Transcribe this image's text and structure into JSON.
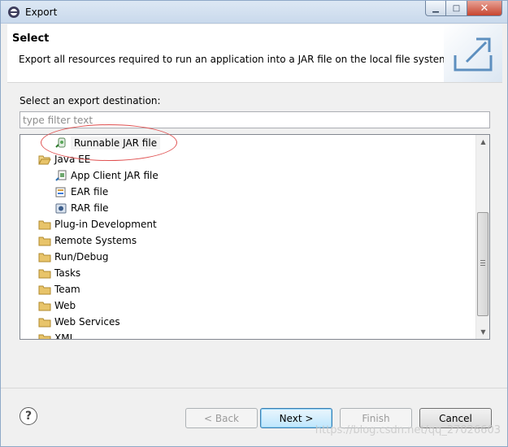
{
  "window": {
    "title": "Export"
  },
  "header": {
    "title": "Select",
    "description": "Export all resources required to run an application into a JAR file on the local file system."
  },
  "body": {
    "dest_label": "Select an export destination:",
    "filter_placeholder": "type filter text"
  },
  "tree": {
    "items": [
      {
        "label": "Runnable JAR file",
        "icon": "jar-runnable-icon",
        "level": 1
      },
      {
        "label": "Java EE",
        "icon": "folder-open-icon",
        "level": 0
      },
      {
        "label": "App Client JAR file",
        "icon": "app-client-icon",
        "level": 1
      },
      {
        "label": "EAR file",
        "icon": "ear-icon",
        "level": 1
      },
      {
        "label": "RAR file",
        "icon": "rar-icon",
        "level": 1
      },
      {
        "label": "Plug-in Development",
        "icon": "folder-icon",
        "level": 0
      },
      {
        "label": "Remote Systems",
        "icon": "folder-icon",
        "level": 0
      },
      {
        "label": "Run/Debug",
        "icon": "folder-icon",
        "level": 0
      },
      {
        "label": "Tasks",
        "icon": "folder-icon",
        "level": 0
      },
      {
        "label": "Team",
        "icon": "folder-icon",
        "level": 0
      },
      {
        "label": "Web",
        "icon": "folder-icon",
        "level": 0
      },
      {
        "label": "Web Services",
        "icon": "folder-icon",
        "level": 0
      },
      {
        "label": "XML",
        "icon": "folder-icon",
        "level": 0
      }
    ]
  },
  "buttons": {
    "help": "?",
    "back": "< Back",
    "next": "Next >",
    "finish": "Finish",
    "cancel": "Cancel"
  },
  "watermark": "https://blog.csdn.net/qq_27026603",
  "colors": {
    "annotation": "#e05050",
    "folder": "#e8c46a"
  }
}
